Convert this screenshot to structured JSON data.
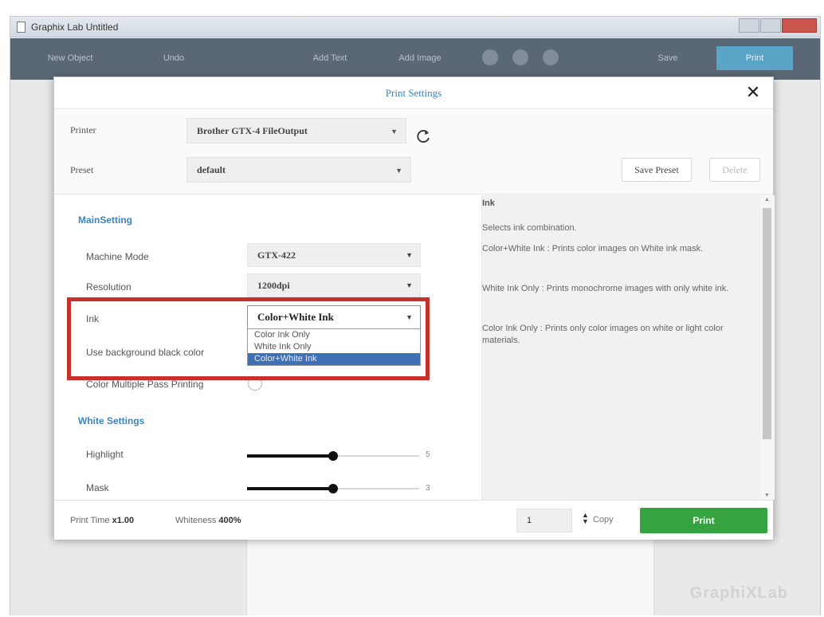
{
  "window": {
    "title": "Graphix Lab Untitled"
  },
  "toolbar": {
    "buttons": [
      "New Object",
      "Undo",
      "Add Text",
      "Add Image",
      "Save"
    ],
    "print_label": "Print"
  },
  "brand": "GraphiXLab",
  "dialog": {
    "title": "Print Settings",
    "close_label": "✕",
    "printer": {
      "label": "Printer",
      "value": "Brother GTX-4 FileOutput"
    },
    "preset": {
      "label": "Preset",
      "value": "default",
      "save_label": "Save Preset",
      "delete_label": "Delete"
    },
    "main_setting": {
      "title": "MainSetting",
      "machine_mode": {
        "label": "Machine Mode",
        "value": "GTX-422"
      },
      "resolution": {
        "label": "Resolution",
        "value": "1200dpi"
      },
      "ink": {
        "label": "Ink",
        "value": "Color+White Ink",
        "options": [
          "Color Ink Only",
          "White Ink Only",
          "Color+White Ink"
        ],
        "selected_index": 2
      },
      "use_background_black": {
        "label": "Use background black color"
      },
      "color_multiple_pass": {
        "label": "Color Multiple Pass Printing"
      }
    },
    "white_settings": {
      "title": "White Settings",
      "highlight": {
        "label": "Highlight",
        "value": "5",
        "fraction": 0.5
      },
      "mask": {
        "label": "Mask",
        "value": "3",
        "fraction": 0.5
      }
    },
    "help": {
      "title": "Ink",
      "paragraphs": [
        "Selects ink combination.",
        "Color+White Ink : Prints color images on White ink mask.",
        "White Ink Only : Prints monochrome images with only white ink.",
        "Color Ink Only : Prints only color images on white or light color materials."
      ]
    },
    "footer": {
      "print_time_label": "Print Time",
      "print_time_value": "x1.00",
      "whiteness_label": "Whiteness",
      "whiteness_value": "400%",
      "copies_value": "1",
      "copy_label": "Copy",
      "print_label": "Print"
    }
  },
  "colors": {
    "accent_blue": "#3c84bd",
    "print_green": "#35a33f",
    "highlight_red": "#c9302c",
    "dropdown_selected": "#3f6fb4"
  }
}
